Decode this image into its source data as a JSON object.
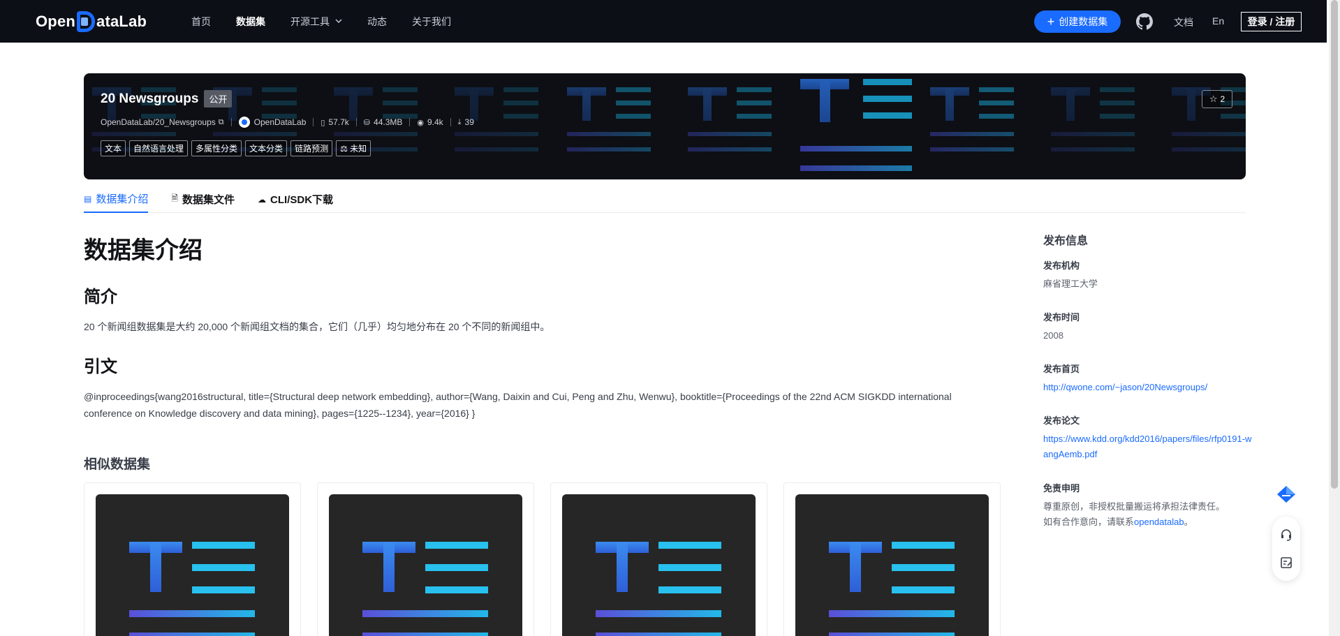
{
  "nav": {
    "logo_left": "Open",
    "logo_right": "ataLab",
    "links": [
      {
        "label": "首页",
        "active": false
      },
      {
        "label": "数据集",
        "active": true
      },
      {
        "label": "开源工具",
        "active": false,
        "dropdown": true
      },
      {
        "label": "动态",
        "active": false
      },
      {
        "label": "关于我们",
        "active": false
      }
    ],
    "create_button": "创建数据集",
    "docs": "文档",
    "lang": "En",
    "login": "登录 / 注册"
  },
  "dataset": {
    "name": "20 Newsgroups",
    "visibility": "公开",
    "path": "OpenDataLab/20_Newsgroups",
    "org": "OpenDataLab",
    "files": "57.7k",
    "size": "44.3MB",
    "views": "9.4k",
    "downloads": "39",
    "stars": "2",
    "tags": [
      "文本",
      "自然语言处理",
      "多属性分类",
      "文本分类",
      "链路预测",
      "未知"
    ]
  },
  "tabs": [
    {
      "label": "数据集介绍",
      "icon": "list-icon",
      "active": true
    },
    {
      "label": "数据集文件",
      "icon": "file-icon",
      "active": false
    },
    {
      "label": "CLI/SDK下载",
      "icon": "cloud-download-icon",
      "active": false
    }
  ],
  "content": {
    "heading": "数据集介绍",
    "intro_heading": "简介",
    "intro_text": "20 个新闻组数据集是大约 20,000 个新闻组文档的集合，它们（几乎）均匀地分布在 20 个不同的新闻组中。",
    "citation_heading": "引文",
    "citation_text": "@inproceedings{wang2016structural, title={Structural deep network embedding}, author={Wang, Daixin and Cui, Peng and Zhu, Wenwu}, booktitle={Proceedings of the 22nd ACM SIGKDD international conference on Knowledge discovery and data mining}, pages={1225--1234}, year={2016} }",
    "similar_heading": "相似数据集"
  },
  "sidebar": {
    "title": "发布信息",
    "org_label": "发布机构",
    "org_value": "麻省理工大学",
    "time_label": "发布时间",
    "time_value": "2008",
    "homepage_label": "发布首页",
    "homepage_value": "http://qwone.com/~jason/20Newsgroups/",
    "paper_label": "发布论文",
    "paper_value": "https://www.kdd.org/kdd2016/papers/files/rfp0191-wangAemb.pdf",
    "disclaimer_label": "免责申明",
    "disclaimer_line1": "尊重原创，非授权批量搬运将承担法律责任。",
    "disclaimer_line2_prefix": "如有合作意向，请联系",
    "disclaimer_link": "opendatalab",
    "disclaimer_line2_suffix": "。"
  },
  "colors": {
    "accent": "#1a6bff",
    "nav_bg": "#0c0f16",
    "text_primary": "#121316",
    "text_secondary": "#5b606b"
  }
}
